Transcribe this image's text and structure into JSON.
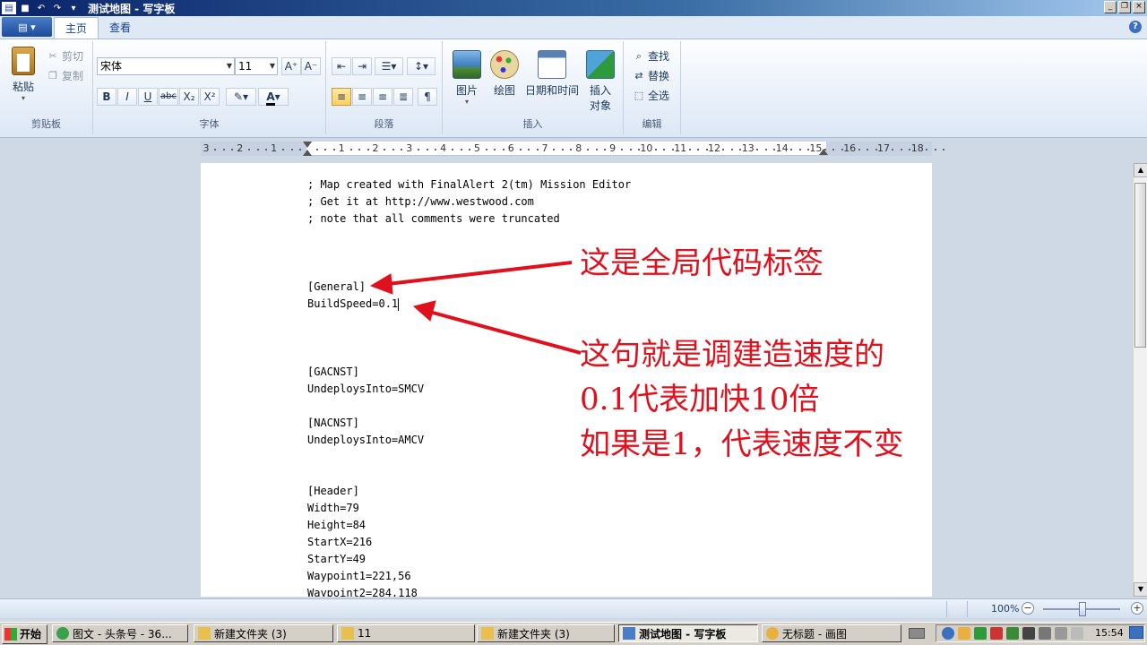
{
  "window": {
    "title": "测试地图 - 写字板",
    "controls": {
      "minimize": "_",
      "restore": "❐",
      "close": "×"
    }
  },
  "ribbon": {
    "app_menu_label": "▤ ▾",
    "tabs": [
      {
        "label": "主页",
        "active": true
      },
      {
        "label": "查看",
        "active": false
      }
    ],
    "clipboard": {
      "paste": "粘贴",
      "cut": "剪切",
      "copy": "复制",
      "label": "剪贴板"
    },
    "font": {
      "family": "宋体",
      "size": "11",
      "label": "字体",
      "grow": "A⁺",
      "shrink": "A⁻",
      "bold": "B",
      "italic": "I",
      "underline": "U",
      "strike": "abc",
      "subscript": "X₂",
      "superscript": "X²"
    },
    "paragraph": {
      "label": "段落"
    },
    "insert": {
      "picture": "图片",
      "paint": "绘图",
      "datetime": "日期和时间",
      "object_line1": "插入",
      "object_line2": "对象",
      "label": "插入"
    },
    "editing": {
      "find": "查找",
      "replace": "替换",
      "select_all": "全选",
      "label": "编辑"
    }
  },
  "ruler": {
    "labels": [
      "3",
      "2",
      "1",
      "",
      "1",
      "2",
      "3",
      "4",
      "5",
      "6",
      "7",
      "8",
      "9",
      "10",
      "11",
      "12",
      "13",
      "14",
      "15",
      "16",
      "17",
      "18"
    ]
  },
  "document": {
    "lines": [
      "; Map created with FinalAlert 2(tm) Mission Editor",
      "; Get it at http://www.westwood.com",
      "; note that all comments were truncated",
      "[General]",
      "BuildSpeed=0.1",
      "[GACNST]",
      "UndeploysInto=SMCV",
      "[NACNST]",
      "UndeploysInto=AMCV",
      "[Header]",
      "Width=79",
      "Height=84",
      "StartX=216",
      "StartY=49",
      "Waypoint1=221,56",
      "Waypoint2=284,118"
    ],
    "annotations": {
      "global_tag": "这是全局代码标签",
      "speed_line1": "这句就是调建造速度的",
      "speed_line2": "0.1代表加快10倍",
      "speed_line3": "如果是1，代表速度不变"
    },
    "annotation_color": "#e0101c"
  },
  "status": {
    "zoom": "100%"
  },
  "taskbar": {
    "start": "开始",
    "buttons": [
      {
        "label": "图文 - 头条号 - 36..."
      },
      {
        "label": "新建文件夹 (3)"
      },
      {
        "label": "11"
      },
      {
        "label": "新建文件夹 (3)"
      },
      {
        "label": "测试地图 - 写字板"
      },
      {
        "label": "无标题 - 画图"
      }
    ],
    "clock": "15:54"
  }
}
